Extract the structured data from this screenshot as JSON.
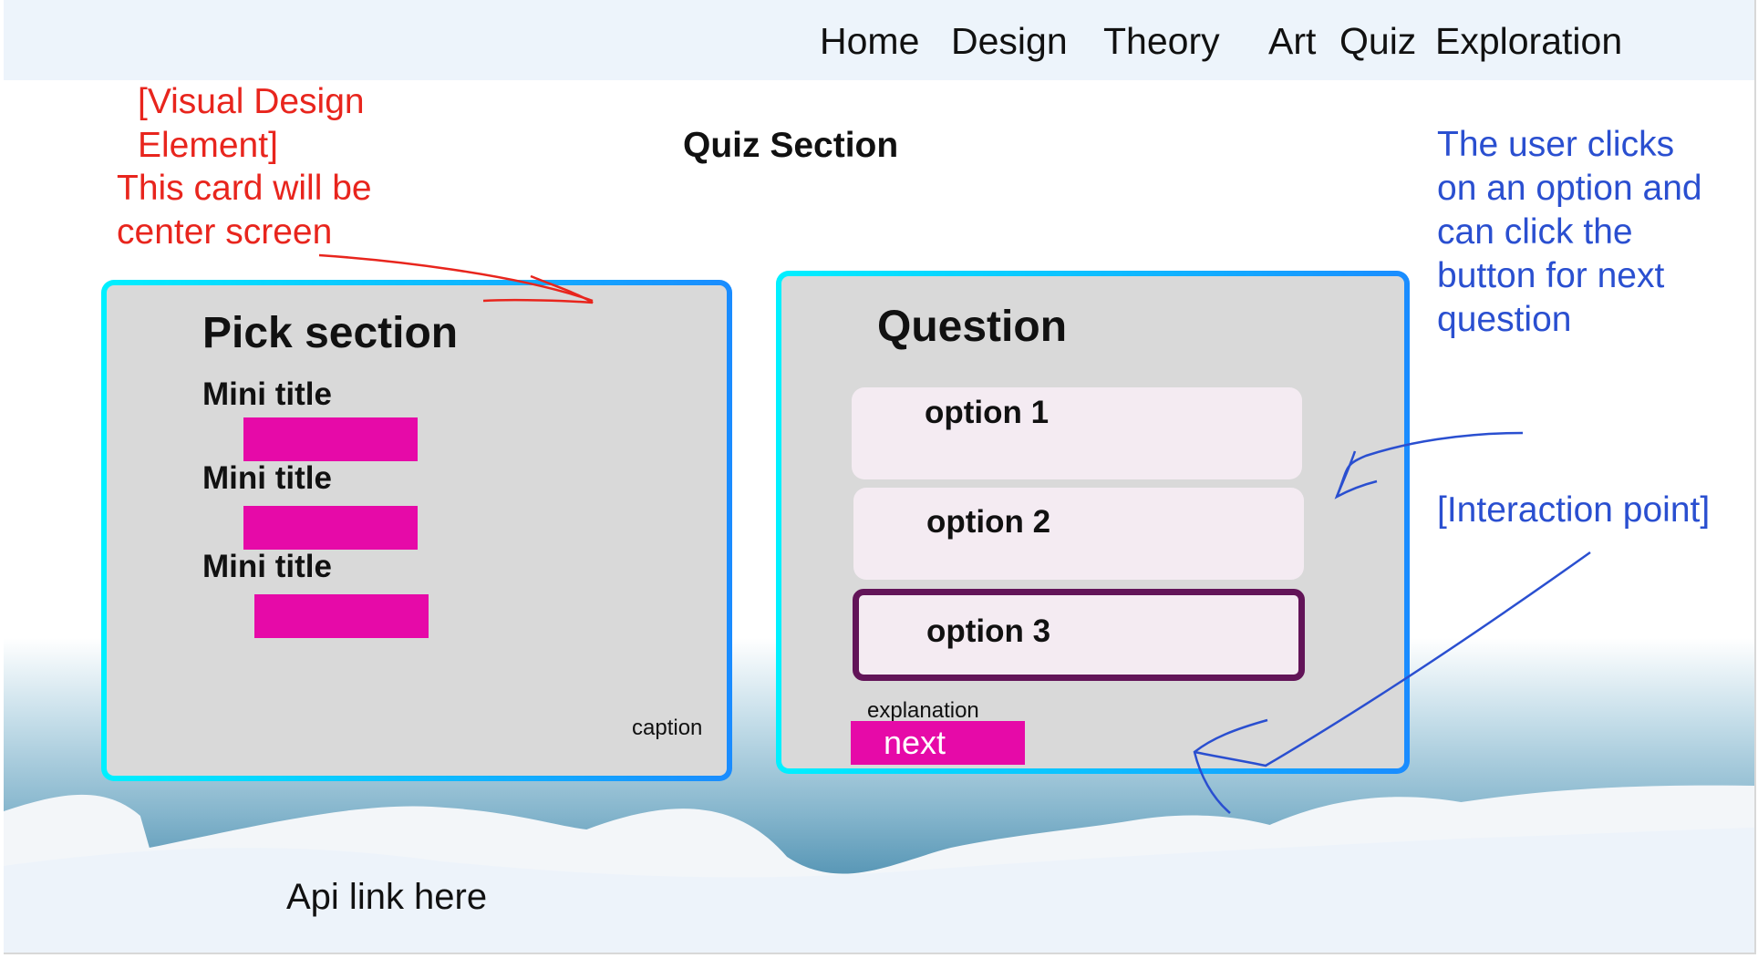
{
  "nav": {
    "items": [
      {
        "label": "Home"
      },
      {
        "label": "Design"
      },
      {
        "label": "Theory"
      },
      {
        "label": "Art"
      },
      {
        "label": "Quiz"
      },
      {
        "label": "Exploration"
      }
    ]
  },
  "page_title": "Quiz Section",
  "pick_card": {
    "heading": "Pick section",
    "sections": [
      {
        "title": "Mini title"
      },
      {
        "title": "Mini title"
      },
      {
        "title": "Mini title"
      }
    ],
    "caption": "caption"
  },
  "question_card": {
    "heading": "Question",
    "options": [
      {
        "label": "option 1",
        "selected": false
      },
      {
        "label": "option 2",
        "selected": false
      },
      {
        "label": "option 3",
        "selected": true
      }
    ],
    "explanation": "explanation",
    "next_label": "next"
  },
  "annotations": {
    "visual_element_line1": "[Visual Design",
    "visual_element_line2": "Element]",
    "center_note_line1": "This card will be",
    "center_note_line2": "center screen",
    "user_note_lines": [
      "The user clicks",
      "on an option and",
      "can click the",
      "button for next",
      "question"
    ],
    "interaction_point": "[Interaction point]"
  },
  "footer": {
    "api_link": "Api link here"
  },
  "colors": {
    "accent_magenta": "#e60aa8",
    "selected_border": "#621458",
    "card_border_start": "#00f0ff",
    "card_border_end": "#1a8cff",
    "annotation_red": "#e8251d",
    "annotation_blue": "#2a4fd0"
  }
}
